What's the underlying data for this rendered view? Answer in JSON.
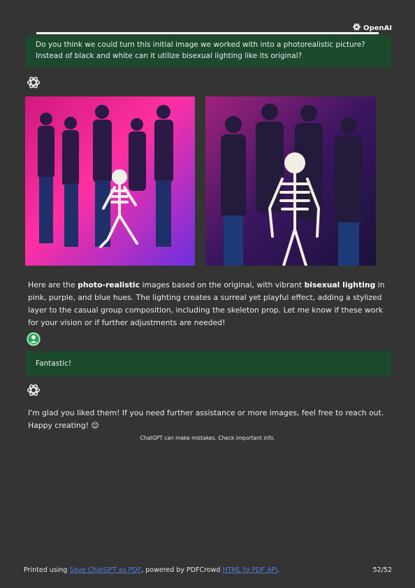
{
  "brand": {
    "name": "OpenAI"
  },
  "messages": {
    "user1": "Do you think we could turn this initial image we worked with into a photorealistic picture? Instead of black and white can it utilize bisexual lighting like its original?",
    "reply1": {
      "p1": "Here are the ",
      "b1": "photo-realistic",
      "p2": " images based on the original, with vibrant ",
      "b2": "bisexual lighting",
      "p3": " in pink, purple, and blue hues. The lighting creates a surreal yet playful effect, adding a stylized layer to the casual group composition, including the skeleton prop. Let me know if these work for your vision or if further adjustments are needed!"
    },
    "user2": "Fantastic!",
    "reply2": {
      "text": "I'm glad you liked them! If you need further assistance or more images, feel free to reach out. Happy creating! ",
      "emoji": "😊"
    }
  },
  "disclaimer": "ChatGPT can make mistakes. Check important info.",
  "footer": {
    "prefix": "Printed using ",
    "link1": "Save ChatGPT as PDF",
    "middle": ", powered by PDFCrowd ",
    "link2": "HTML to PDF API",
    "suffix": ".",
    "page": "52/52"
  },
  "colors": {
    "background": "#343434",
    "user_bubble": "#1b4a2c",
    "link": "#4f7fe0",
    "user_avatar": "#2e9e5b"
  }
}
